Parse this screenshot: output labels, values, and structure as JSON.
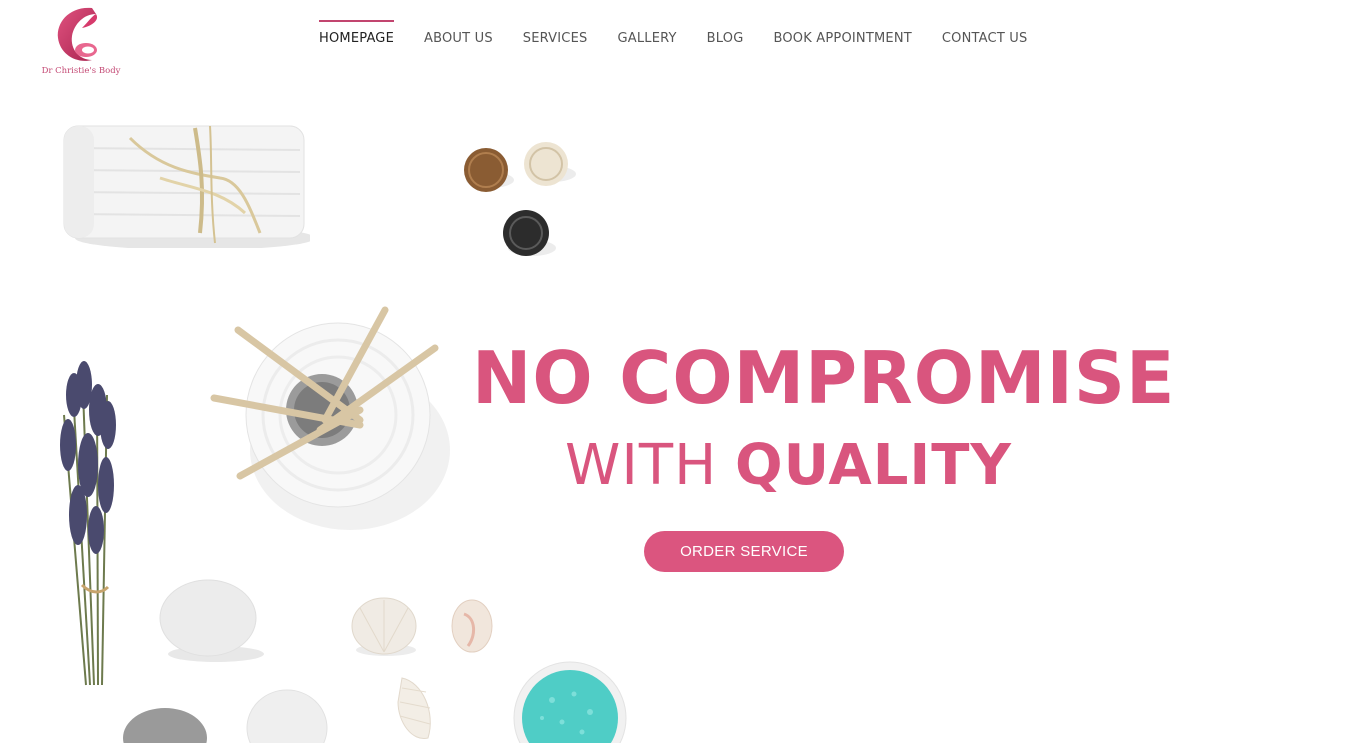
{
  "brand": {
    "logo_text": "Dr Christie's Body",
    "accent_color": "#d9557e"
  },
  "nav": {
    "items": [
      {
        "label": "HOMEPAGE",
        "active": true
      },
      {
        "label": "ABOUT US"
      },
      {
        "label": "SERVICES"
      },
      {
        "label": "GALLERY"
      },
      {
        "label": "BLOG"
      },
      {
        "label": "BOOK APPOINTMENT"
      },
      {
        "label": "CONTACT US"
      }
    ]
  },
  "hero": {
    "title": "NO COMPROMISE",
    "subtitle_light": "WITH",
    "subtitle_bold": "QUALITY",
    "cta_label": "ORDER SERVICE"
  },
  "decorations": [
    "towel-image",
    "wicker-balls-image",
    "reed-diffuser-image",
    "lavender-image",
    "stones-image",
    "seashells-image",
    "bath-salt-bowl-image"
  ]
}
